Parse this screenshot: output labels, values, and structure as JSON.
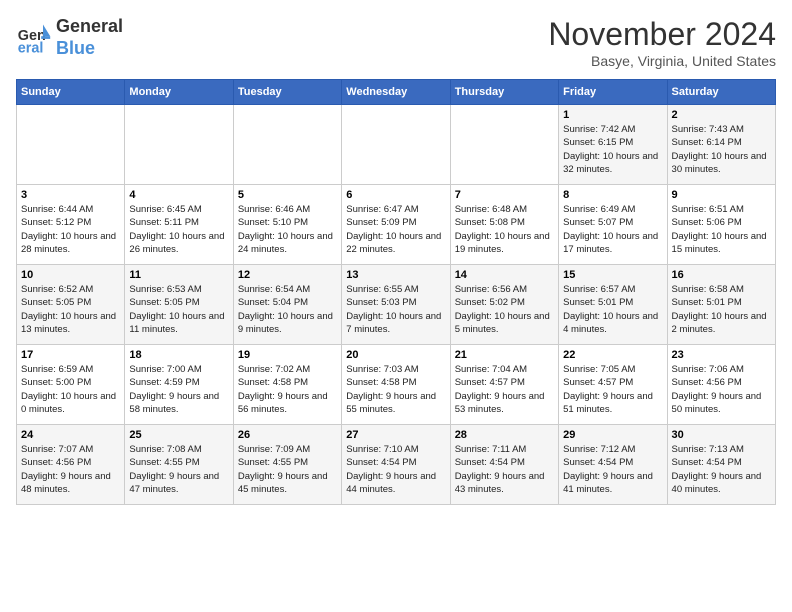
{
  "header": {
    "logo_line1": "General",
    "logo_line2": "Blue",
    "month": "November 2024",
    "location": "Basye, Virginia, United States"
  },
  "days_of_week": [
    "Sunday",
    "Monday",
    "Tuesday",
    "Wednesday",
    "Thursday",
    "Friday",
    "Saturday"
  ],
  "weeks": [
    [
      {
        "day": null
      },
      {
        "day": null
      },
      {
        "day": null
      },
      {
        "day": null
      },
      {
        "day": null
      },
      {
        "day": "1",
        "sunrise": "Sunrise: 7:42 AM",
        "sunset": "Sunset: 6:15 PM",
        "daylight": "Daylight: 10 hours and 32 minutes."
      },
      {
        "day": "2",
        "sunrise": "Sunrise: 7:43 AM",
        "sunset": "Sunset: 6:14 PM",
        "daylight": "Daylight: 10 hours and 30 minutes."
      }
    ],
    [
      {
        "day": "3",
        "sunrise": "Sunrise: 6:44 AM",
        "sunset": "Sunset: 5:12 PM",
        "daylight": "Daylight: 10 hours and 28 minutes."
      },
      {
        "day": "4",
        "sunrise": "Sunrise: 6:45 AM",
        "sunset": "Sunset: 5:11 PM",
        "daylight": "Daylight: 10 hours and 26 minutes."
      },
      {
        "day": "5",
        "sunrise": "Sunrise: 6:46 AM",
        "sunset": "Sunset: 5:10 PM",
        "daylight": "Daylight: 10 hours and 24 minutes."
      },
      {
        "day": "6",
        "sunrise": "Sunrise: 6:47 AM",
        "sunset": "Sunset: 5:09 PM",
        "daylight": "Daylight: 10 hours and 22 minutes."
      },
      {
        "day": "7",
        "sunrise": "Sunrise: 6:48 AM",
        "sunset": "Sunset: 5:08 PM",
        "daylight": "Daylight: 10 hours and 19 minutes."
      },
      {
        "day": "8",
        "sunrise": "Sunrise: 6:49 AM",
        "sunset": "Sunset: 5:07 PM",
        "daylight": "Daylight: 10 hours and 17 minutes."
      },
      {
        "day": "9",
        "sunrise": "Sunrise: 6:51 AM",
        "sunset": "Sunset: 5:06 PM",
        "daylight": "Daylight: 10 hours and 15 minutes."
      }
    ],
    [
      {
        "day": "10",
        "sunrise": "Sunrise: 6:52 AM",
        "sunset": "Sunset: 5:05 PM",
        "daylight": "Daylight: 10 hours and 13 minutes."
      },
      {
        "day": "11",
        "sunrise": "Sunrise: 6:53 AM",
        "sunset": "Sunset: 5:05 PM",
        "daylight": "Daylight: 10 hours and 11 minutes."
      },
      {
        "day": "12",
        "sunrise": "Sunrise: 6:54 AM",
        "sunset": "Sunset: 5:04 PM",
        "daylight": "Daylight: 10 hours and 9 minutes."
      },
      {
        "day": "13",
        "sunrise": "Sunrise: 6:55 AM",
        "sunset": "Sunset: 5:03 PM",
        "daylight": "Daylight: 10 hours and 7 minutes."
      },
      {
        "day": "14",
        "sunrise": "Sunrise: 6:56 AM",
        "sunset": "Sunset: 5:02 PM",
        "daylight": "Daylight: 10 hours and 5 minutes."
      },
      {
        "day": "15",
        "sunrise": "Sunrise: 6:57 AM",
        "sunset": "Sunset: 5:01 PM",
        "daylight": "Daylight: 10 hours and 4 minutes."
      },
      {
        "day": "16",
        "sunrise": "Sunrise: 6:58 AM",
        "sunset": "Sunset: 5:01 PM",
        "daylight": "Daylight: 10 hours and 2 minutes."
      }
    ],
    [
      {
        "day": "17",
        "sunrise": "Sunrise: 6:59 AM",
        "sunset": "Sunset: 5:00 PM",
        "daylight": "Daylight: 10 hours and 0 minutes."
      },
      {
        "day": "18",
        "sunrise": "Sunrise: 7:00 AM",
        "sunset": "Sunset: 4:59 PM",
        "daylight": "Daylight: 9 hours and 58 minutes."
      },
      {
        "day": "19",
        "sunrise": "Sunrise: 7:02 AM",
        "sunset": "Sunset: 4:58 PM",
        "daylight": "Daylight: 9 hours and 56 minutes."
      },
      {
        "day": "20",
        "sunrise": "Sunrise: 7:03 AM",
        "sunset": "Sunset: 4:58 PM",
        "daylight": "Daylight: 9 hours and 55 minutes."
      },
      {
        "day": "21",
        "sunrise": "Sunrise: 7:04 AM",
        "sunset": "Sunset: 4:57 PM",
        "daylight": "Daylight: 9 hours and 53 minutes."
      },
      {
        "day": "22",
        "sunrise": "Sunrise: 7:05 AM",
        "sunset": "Sunset: 4:57 PM",
        "daylight": "Daylight: 9 hours and 51 minutes."
      },
      {
        "day": "23",
        "sunrise": "Sunrise: 7:06 AM",
        "sunset": "Sunset: 4:56 PM",
        "daylight": "Daylight: 9 hours and 50 minutes."
      }
    ],
    [
      {
        "day": "24",
        "sunrise": "Sunrise: 7:07 AM",
        "sunset": "Sunset: 4:56 PM",
        "daylight": "Daylight: 9 hours and 48 minutes."
      },
      {
        "day": "25",
        "sunrise": "Sunrise: 7:08 AM",
        "sunset": "Sunset: 4:55 PM",
        "daylight": "Daylight: 9 hours and 47 minutes."
      },
      {
        "day": "26",
        "sunrise": "Sunrise: 7:09 AM",
        "sunset": "Sunset: 4:55 PM",
        "daylight": "Daylight: 9 hours and 45 minutes."
      },
      {
        "day": "27",
        "sunrise": "Sunrise: 7:10 AM",
        "sunset": "Sunset: 4:54 PM",
        "daylight": "Daylight: 9 hours and 44 minutes."
      },
      {
        "day": "28",
        "sunrise": "Sunrise: 7:11 AM",
        "sunset": "Sunset: 4:54 PM",
        "daylight": "Daylight: 9 hours and 43 minutes."
      },
      {
        "day": "29",
        "sunrise": "Sunrise: 7:12 AM",
        "sunset": "Sunset: 4:54 PM",
        "daylight": "Daylight: 9 hours and 41 minutes."
      },
      {
        "day": "30",
        "sunrise": "Sunrise: 7:13 AM",
        "sunset": "Sunset: 4:54 PM",
        "daylight": "Daylight: 9 hours and 40 minutes."
      }
    ]
  ]
}
